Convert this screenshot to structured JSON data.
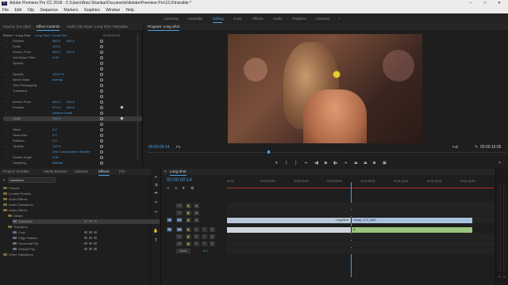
{
  "window": {
    "title": "Adobe Premiere Pro CC 2018 - C:\\Users\\Ravi Shankar\\Documents\\Adobe\\Premiere Pro\\12.0\\Invisible *",
    "controls": {
      "minimize": "–",
      "maximize": "□",
      "close": "✕"
    }
  },
  "menu": [
    "File",
    "Edit",
    "Clip",
    "Sequence",
    "Markers",
    "Graphics",
    "Window",
    "Help"
  ],
  "workspaces": {
    "items": [
      "Learning",
      "Assembly",
      "Editing",
      "Color",
      "Effects",
      "Audio",
      "Graphics",
      "Libraries"
    ],
    "active": "Editing",
    "more": "»"
  },
  "source_tabs": [
    "Source: (no clips)",
    "Effect Controls",
    "Audio Clip Mixer: Long Shot",
    "Metadata"
  ],
  "effect_controls": {
    "master": "Master * Long Shot",
    "sequence": "Long Shot * Long Shot",
    "timecode": "00:00:00:12",
    "rows": [
      {
        "label": "Position",
        "v1": "960.0",
        "v2": "540.0"
      },
      {
        "label": "Scale",
        "v1": "100.0",
        "v2": ""
      },
      {
        "label": "Anchor Point",
        "v1": "960.0",
        "v2": "540.0"
      },
      {
        "label": "Anti-flicker Filter",
        "v1": "0.00",
        "v2": ""
      },
      {
        "label": "Opacity",
        "v1": "",
        "v2": ""
      },
      {
        "label": "",
        "v1": "",
        "v2": ""
      },
      {
        "label": "Opacity",
        "v1": "100.0 %",
        "v2": ""
      },
      {
        "label": "Blend Mode",
        "v1": "Normal",
        "v2": ""
      },
      {
        "label": "Time Remapping",
        "v1": "",
        "v2": ""
      },
      {
        "label": "Transform",
        "v1": "",
        "v2": ""
      },
      {
        "label": "",
        "v1": "",
        "v2": ""
      },
      {
        "label": "Anchor Point",
        "v1": "960.0",
        "v2": "540.0"
      },
      {
        "label": "Position",
        "v1": "974.0",
        "v2": "540.0"
      },
      {
        "label": "",
        "v1": "Uniform Scale",
        "v2": ""
      },
      {
        "label": "Scale",
        "v1": "100.0",
        "v2": ""
      },
      {
        "label": "",
        "v1": "",
        "v2": ""
      },
      {
        "label": "Skew",
        "v1": "0.0",
        "v2": ""
      },
      {
        "label": "Skew Axis",
        "v1": "0.0",
        "v2": ""
      },
      {
        "label": "Rotation",
        "v1": "0.0",
        "v2": ""
      },
      {
        "label": "Opacity",
        "v1": "100.0",
        "v2": ""
      },
      {
        "label": "",
        "v1": "Use Composition's Shutter",
        "v2": ""
      },
      {
        "label": "Shutter Angle",
        "v1": "0.00",
        "v2": ""
      },
      {
        "label": "Sampling",
        "v1": "Bilinear",
        "v2": ""
      }
    ]
  },
  "program": {
    "tab": "Program: Long Shot",
    "timecode_left": "00:00:00:14",
    "fit": "Fit",
    "quality": "Full",
    "timecode_right": "00:00:16:05"
  },
  "project": {
    "tabs": [
      "Project: Invisible",
      "Media Browser",
      "Libraries",
      "Effects",
      "Info"
    ],
    "active_tab": "Effects",
    "search_value": "transform",
    "tree": [
      {
        "indent": 0,
        "label": "Presets",
        "folder": true
      },
      {
        "indent": 0,
        "label": "Lumetri Presets",
        "folder": true
      },
      {
        "indent": 0,
        "label": "Audio Effects",
        "folder": true
      },
      {
        "indent": 0,
        "label": "Audio Transitions",
        "folder": true
      },
      {
        "indent": 0,
        "label": "Video Effects",
        "folder": true
      },
      {
        "indent": 1,
        "label": "Distort",
        "folder": true
      },
      {
        "indent": 2,
        "label": "Transform",
        "folder": false,
        "selected": true
      },
      {
        "indent": 1,
        "label": "Transform",
        "folder": true
      },
      {
        "indent": 2,
        "label": "Crop",
        "folder": false
      },
      {
        "indent": 2,
        "label": "Edge Feather",
        "folder": false
      },
      {
        "indent": 2,
        "label": "Horizontal Flip",
        "folder": false
      },
      {
        "indent": 2,
        "label": "Vertical Flip",
        "folder": false
      },
      {
        "indent": 0,
        "label": "Video Transitions",
        "folder": true
      }
    ]
  },
  "timeline": {
    "tab": "Long Shot",
    "timecode": "00:00:00:14",
    "ruler": [
      "00:00",
      "00:00:15:00",
      "00:00:30:00",
      "00:00:45:00",
      "00:01:00:00",
      "00:01:15:00",
      "00:01:30:00",
      "00:01:45:00"
    ],
    "tracks": [
      {
        "name": "V3",
        "target": ""
      },
      {
        "name": "V2",
        "target": ""
      },
      {
        "name": "V1",
        "target": "V1"
      },
      {
        "name": "A1",
        "target": "A1"
      },
      {
        "name": "A2",
        "target": ""
      },
      {
        "name": "A3",
        "target": ""
      },
      {
        "name": "Master",
        "target": "",
        "value": "0.0"
      }
    ],
    "clips": [
      {
        "track": "V1",
        "label": "Long Shot"
      },
      {
        "track": "V1",
        "label": "Cheap_CTV_MAX"
      },
      {
        "track": "A1",
        "label": "fx"
      }
    ]
  },
  "colors": {
    "accent": "#4a9fe0",
    "clip_video": "#a9c1e0",
    "clip_audio": "#9bc37d",
    "playhead": "#4a9fe0"
  }
}
